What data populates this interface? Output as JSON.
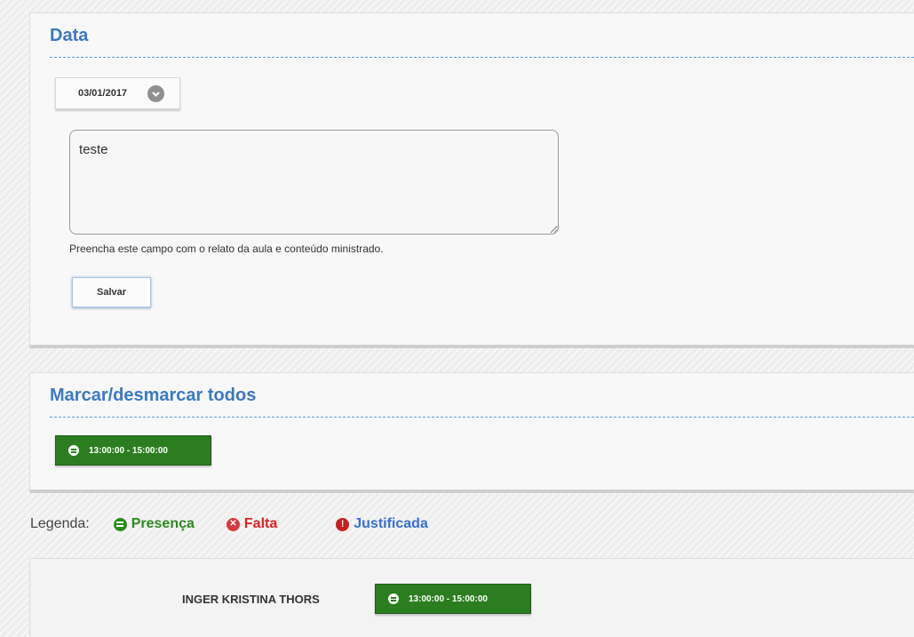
{
  "data_section": {
    "title": "Data",
    "date_value": "03/01/2017",
    "report_text": "teste",
    "help_text": "Preencha este campo com o relato da aula e conteúdo ministrado.",
    "save_label": "Salvar"
  },
  "marcar_section": {
    "title": "Marcar/desmarcar todos",
    "time_range": "13:00:00 - 15:00:00"
  },
  "legend": {
    "label": "Legenda:",
    "items": [
      {
        "label": "Presença",
        "icon": "presence-icon",
        "color": "#2d8a1f"
      },
      {
        "label": "Falta",
        "icon": "absence-icon",
        "color": "#e02020"
      },
      {
        "label": "Justificada",
        "icon": "justified-icon",
        "color": "#3b6fd6"
      }
    ]
  },
  "students": [
    {
      "name": "INGER KRISTINA THORS",
      "time_range": "13:00:00 - 15:00:00",
      "status": "Presença"
    }
  ],
  "colors": {
    "title_blue": "#3c79c2",
    "presence_green": "#2b7d1f"
  }
}
